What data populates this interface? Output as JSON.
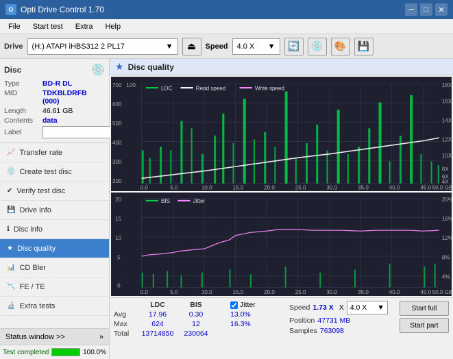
{
  "titleBar": {
    "title": "Opti Drive Control 1.70",
    "icon": "O",
    "minimize": "─",
    "maximize": "□",
    "close": "✕"
  },
  "menuBar": {
    "items": [
      "File",
      "Start test",
      "Extra",
      "Help"
    ]
  },
  "driveBar": {
    "label": "Drive",
    "driveValue": "(H:) ATAPI iHBS312  2 PL17",
    "speedLabel": "Speed",
    "speedValue": "4.0 X"
  },
  "disc": {
    "sectionTitle": "Disc",
    "typeLabel": "Type",
    "typeValue": "BD-R DL",
    "midLabel": "MID",
    "midValue": "TDKBLDRFB (000)",
    "lengthLabel": "Length",
    "lengthValue": "46.61 GB",
    "contentsLabel": "Contents",
    "contentsValue": "data",
    "labelLabel": "Label",
    "labelValue": ""
  },
  "navItems": [
    {
      "id": "transfer-rate",
      "label": "Transfer rate",
      "icon": "📈"
    },
    {
      "id": "create-test-disc",
      "label": "Create test disc",
      "icon": "💿"
    },
    {
      "id": "verify-test-disc",
      "label": "Verify test disc",
      "icon": "✔"
    },
    {
      "id": "drive-info",
      "label": "Drive info",
      "icon": "💾"
    },
    {
      "id": "disc-info",
      "label": "Disc info",
      "icon": "ℹ"
    },
    {
      "id": "disc-quality",
      "label": "Disc quality",
      "icon": "★",
      "active": true
    },
    {
      "id": "cd-bler",
      "label": "CD Bler",
      "icon": "📊"
    },
    {
      "id": "fe-te",
      "label": "FE / TE",
      "icon": "📉"
    },
    {
      "id": "extra-tests",
      "label": "Extra tests",
      "icon": "🔬"
    }
  ],
  "statusWindow": {
    "label": "Status window >>",
    "progressText": "Test completed",
    "progressPct": "100.0%",
    "fillWidth": "100"
  },
  "discQuality": {
    "title": "Disc quality",
    "icon": "★",
    "legend": {
      "ldc": "LDC",
      "readSpeed": "Read speed",
      "writeSpeed": "Write speed",
      "bis": "BIS",
      "jitter": "Jitter"
    }
  },
  "stats": {
    "headers": [
      "",
      "LDC",
      "BIS",
      "",
      "Jitter",
      "Speed",
      ""
    ],
    "rows": [
      {
        "label": "Avg",
        "ldc": "17.96",
        "bis": "0.30",
        "jitter": "13.0%",
        "speed": "1.73 X",
        "speedSel": "4.0 X"
      },
      {
        "label": "Max",
        "ldc": "624",
        "bis": "12",
        "jitter": "16.3%",
        "position": "47731 MB"
      },
      {
        "label": "Total",
        "ldc": "13714850",
        "bis": "230064",
        "samples": "763098"
      }
    ],
    "jitterChecked": true,
    "jitterLabel": "Jitter",
    "speedLabel": "Speed",
    "speedValue": "1.73 X",
    "speedDropdown": "4.0 X",
    "positionLabel": "Position",
    "positionValue": "47731 MB",
    "samplesLabel": "Samples",
    "samplesValue": "763098",
    "startFull": "Start full",
    "startPart": "Start part"
  }
}
